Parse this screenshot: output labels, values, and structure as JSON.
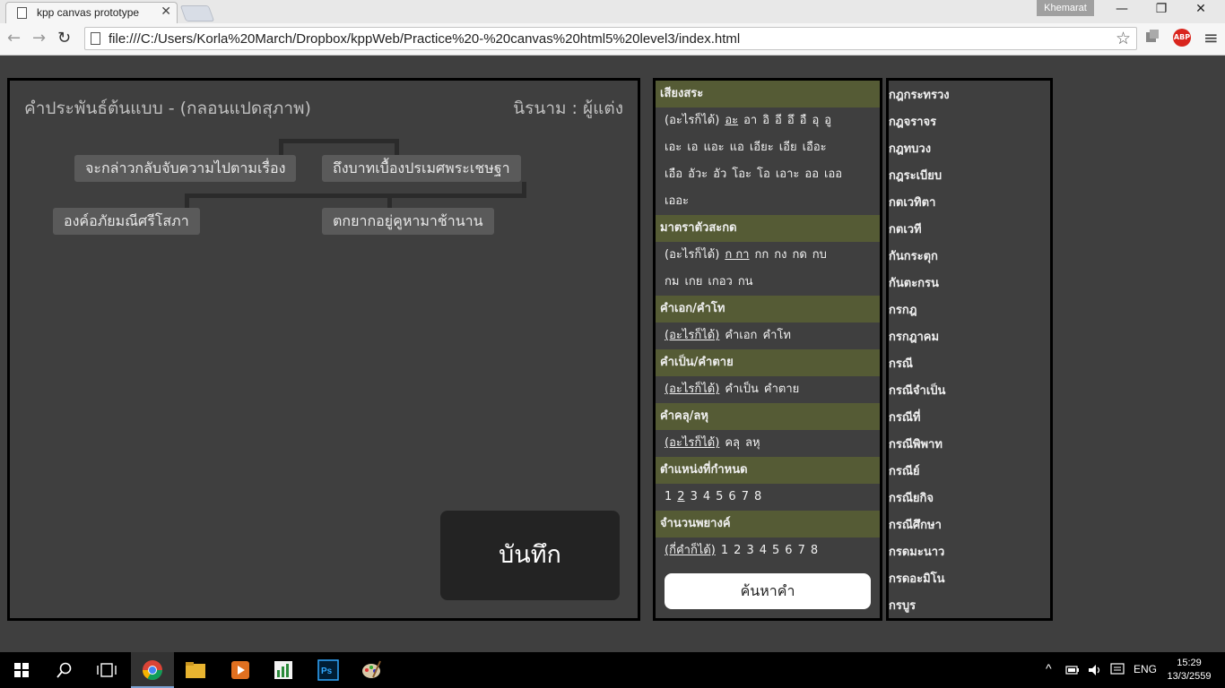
{
  "browser": {
    "tab_title": "kpp canvas prototype",
    "tab_close": "✕",
    "profile_name": "Khemarat",
    "url": "file:///C:/Users/Korla%20March/Dropbox/kppWeb/Practice%20-%20canvas%20html5%20level3/index.html",
    "win_min": "—",
    "win_restore": "❐",
    "win_close": "✕",
    "back": "←",
    "forward": "→",
    "reload": "↻",
    "star": "☆",
    "menu": "≡",
    "abp": "ABP"
  },
  "editor": {
    "title": "คำประพันธ์ต้นแบบ - (กลอนแปดสุภาพ)",
    "author": "นิรนาม : ผู้แต่ง",
    "verses": [
      "จะกล่าวกลับจับความไปตามเรื่อง",
      "ถึงบาทเบื้องปรเมศพระเชษฐา",
      "องค์อภัยมณีศรีโสภา",
      "ตกยากอยู่คูหามาช้านาน"
    ],
    "save_label": "บันทึก"
  },
  "filters": {
    "vowel": {
      "heading": "เสียงสระ",
      "lines": [
        [
          "(อะไรก็ได้)",
          "อะ",
          "อา",
          "อิ",
          "อี",
          "อึ",
          "อื",
          "อุ",
          "อู"
        ],
        [
          "เอะ",
          "เอ",
          "แอะ",
          "แอ",
          "เอียะ",
          "เอีย",
          "เอือะ"
        ],
        [
          "เอือ",
          "อัวะ",
          "อัว",
          "โอะ",
          "โอ",
          "เอาะ",
          "ออ",
          "เออ"
        ],
        [
          "เออะ"
        ]
      ]
    },
    "final": {
      "heading": "มาตราตัวสะกด",
      "lines": [
        [
          "(อะไรก็ได้)",
          "ก กา",
          "กก",
          "กง",
          "กด",
          "กบ"
        ],
        [
          "กม",
          "เกย",
          "เกอว",
          "กน"
        ]
      ]
    },
    "tone": {
      "heading": "คำเอก/คำโท",
      "lines": [
        [
          "(อะไรก็ได้)",
          "คำเอก",
          "คำโท"
        ]
      ]
    },
    "liveness": {
      "heading": "คำเป็น/คำตาย",
      "lines": [
        [
          "(อะไรก็ได้)",
          "คำเป็น",
          "คำตาย"
        ]
      ]
    },
    "weight": {
      "heading": "คำคลุ/ลหุ",
      "lines": [
        [
          "(อะไรก็ได้)",
          "คลุ",
          "ลหุ"
        ]
      ]
    },
    "position": {
      "heading": "ตำแหน่งที่กำหนด",
      "lines": [
        [
          "1",
          "2",
          "3",
          "4",
          "5",
          "6",
          "7",
          "8"
        ]
      ]
    },
    "syllables": {
      "heading": "จำนวนพยางค์",
      "lines": [
        [
          "(กี่คำก็ได้)",
          "1",
          "2",
          "3",
          "4",
          "5",
          "6",
          "7",
          "8"
        ]
      ]
    },
    "selected": {
      "vowel": "อะ",
      "final": "ก กา",
      "tone": "(อะไรก็ได้)",
      "liveness": "(อะไรก็ได้)",
      "weight": "(อะไรก็ได้)",
      "position": "2",
      "syllables": "(กี่คำก็ได้)"
    },
    "search_label": "ค้นหาคำ"
  },
  "wordlist": [
    "กฎกระทรวง",
    "กฎจราจร",
    "กฎทบวง",
    "กฎระเบียบ",
    "กตเวทิตา",
    "กตเวที",
    "กันกระตุก",
    "กันตะกรน",
    "กรกฎ",
    "กรกฎาคม",
    "กรณี",
    "กรณีจำเป็น",
    "กรณีที่",
    "กรณีพิพาท",
    "กรณีย์",
    "กรณียกิจ",
    "กรณีศึกษา",
    "กรดมะนาว",
    "กรดอะมิโน",
    "กรบูร"
  ],
  "taskbar": {
    "lang": "ENG",
    "time": "15:29",
    "date": "13/3/2559"
  },
  "colors": {
    "section_header": "#555b35",
    "panel_bg": "#3f3f3f",
    "verse_bg": "#5a5a5a",
    "save_bg": "#232323"
  }
}
